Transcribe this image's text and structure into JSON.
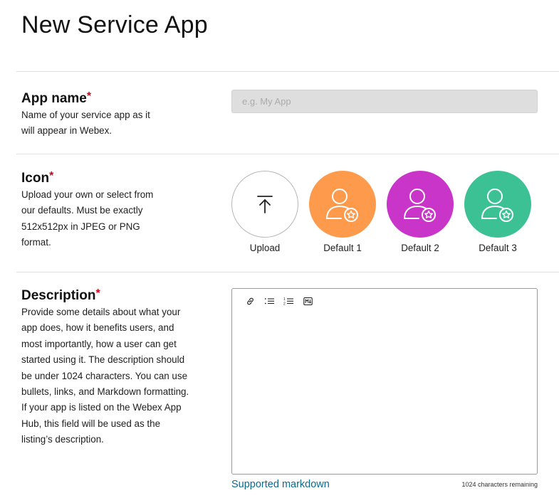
{
  "page": {
    "title": "New Service App"
  },
  "app_name": {
    "title": "App name",
    "required_mark": "*",
    "description": "Name of your service app as it will appear in Webex.",
    "placeholder": "e.g. My App",
    "value": ""
  },
  "icon": {
    "title": "Icon",
    "required_mark": "*",
    "description": "Upload your own or select from our defaults. Must be exactly 512x512px in JPEG or PNG format.",
    "options": [
      {
        "label": "Upload",
        "icon": "upload-arrow-icon",
        "color": "#ffffff"
      },
      {
        "label": "Default 1",
        "icon": "user-star-icon",
        "color": "#fd9a4c"
      },
      {
        "label": "Default 2",
        "icon": "user-star-icon",
        "color": "#c935c9"
      },
      {
        "label": "Default 3",
        "icon": "user-star-icon",
        "color": "#3bc194"
      }
    ]
  },
  "description": {
    "title": "Description",
    "required_mark": "*",
    "description": "Provide some details about what your app does, how it benefits users, and most importantly, how a user can get started using it. The description should be under 1024 characters. You can use bullets, links, and Markdown formatting. If your app is listed on the Webex App Hub, this field will be used as the listing’s description.",
    "toolbar": [
      "link-icon",
      "bulleted-list-icon",
      "numbered-list-icon",
      "markdown-icon"
    ],
    "value": "",
    "supported_markdown_link": "Supported markdown",
    "chars_remaining": "1024 characters remaining"
  },
  "colors": {
    "accent_link": "#0c6a8f",
    "required": "#d0021b"
  }
}
